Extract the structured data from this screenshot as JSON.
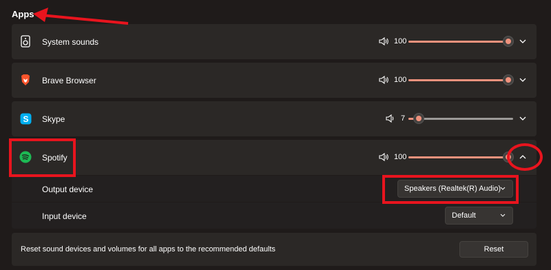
{
  "section": {
    "title": "Apps"
  },
  "apps": [
    {
      "name": "System sounds",
      "icon": "speaker-device-icon",
      "volume": "100",
      "level": 100,
      "expanded": false
    },
    {
      "name": "Brave Browser",
      "icon": "brave-lion-icon",
      "volume": "100",
      "level": 100,
      "expanded": false
    },
    {
      "name": "Skype",
      "icon": "skype-icon",
      "volume": "7",
      "level": 7,
      "expanded": false
    },
    {
      "name": "Spotify",
      "icon": "spotify-icon",
      "volume": "100",
      "level": 100,
      "expanded": true
    }
  ],
  "spotify_details": {
    "output_label": "Output device",
    "output_value": "Speakers (Realtek(R) Audio)",
    "input_label": "Input device",
    "input_value": "Default"
  },
  "reset": {
    "text": "Reset sound devices and volumes for all apps to the recommended defaults",
    "button_label": "Reset"
  },
  "colors": {
    "accent": "#f0927d",
    "annotation": "#e8141e",
    "brave": "#fb542b",
    "skype": "#00aff0",
    "spotify": "#1db954"
  }
}
